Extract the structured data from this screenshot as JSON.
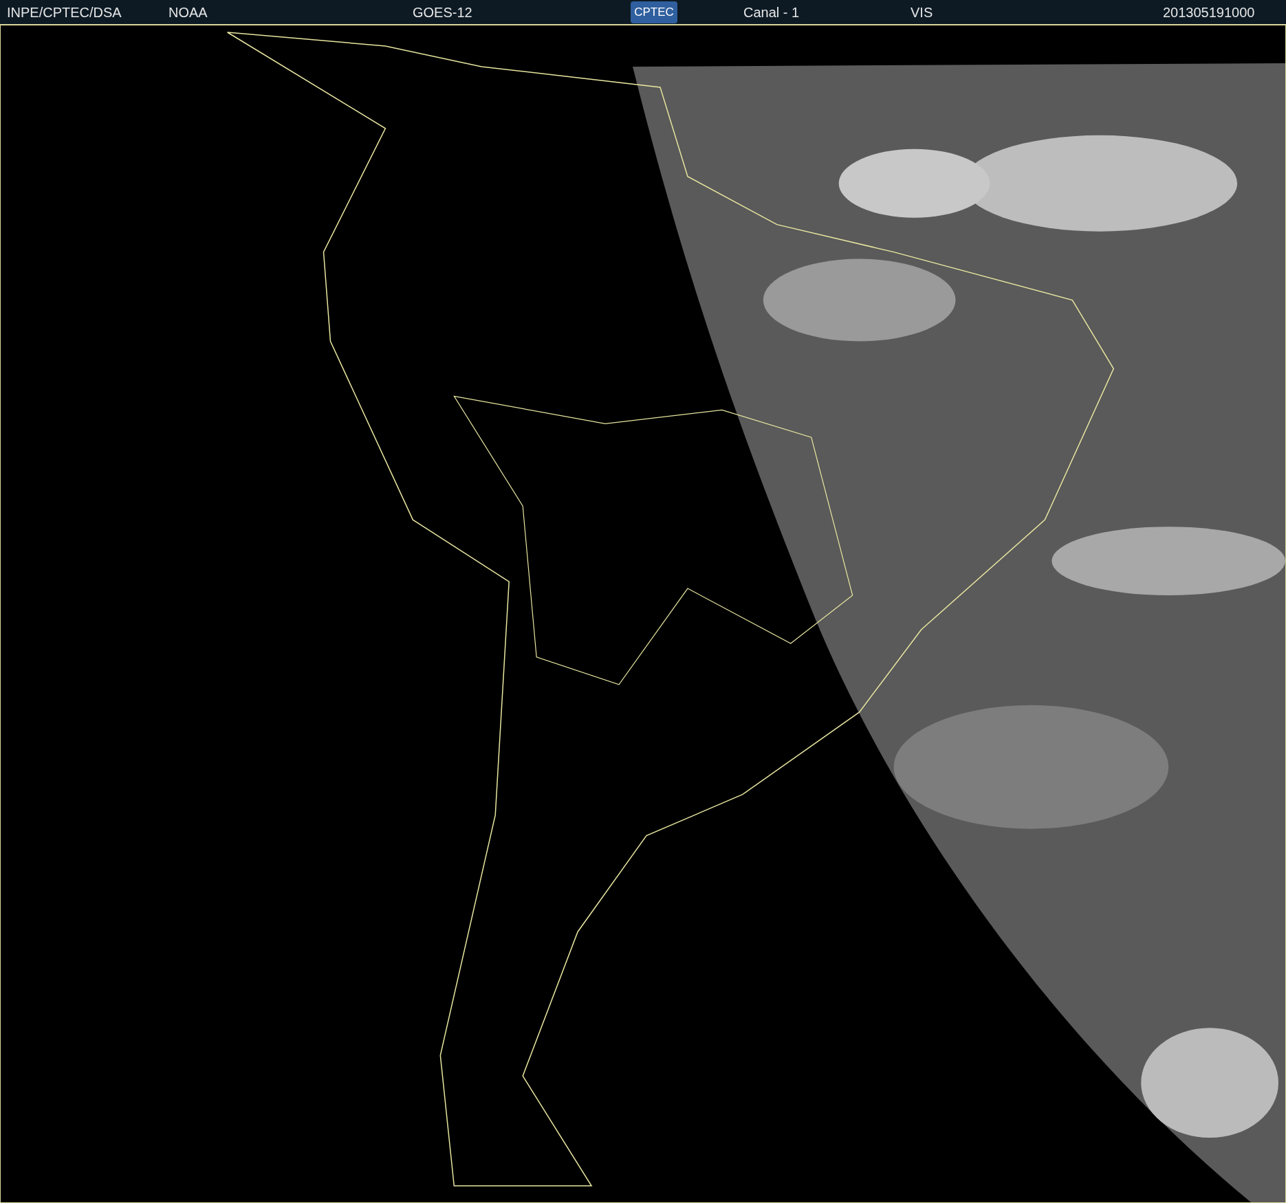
{
  "header": {
    "source": "INPE/CPTEC/DSA",
    "agency": "NOAA",
    "satellite": "GOES-12",
    "logo": "CPTEC",
    "channel": "Canal - 1",
    "band": "VIS",
    "timestamp": "201305191000"
  }
}
